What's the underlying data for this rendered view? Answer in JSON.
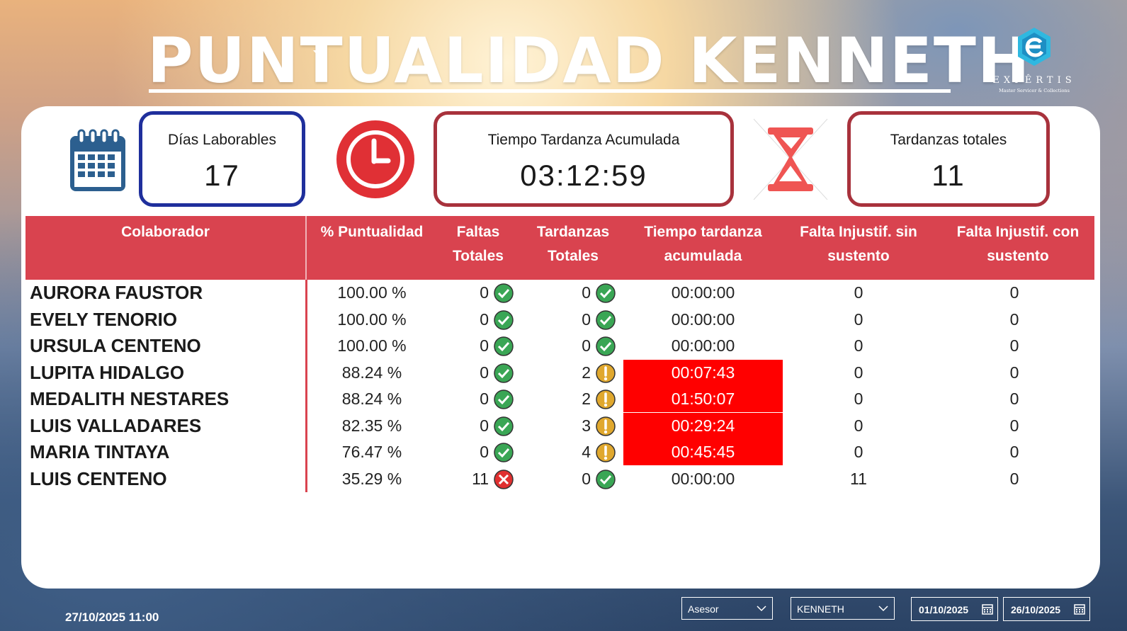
{
  "header": {
    "title": "PUNTUALIDAD KENNETH"
  },
  "logo": {
    "name": "EXPÊRTIS",
    "tagline": "Master Servicer & Collections",
    "icon": "expertis-e-logo"
  },
  "kpis": {
    "dias": {
      "label": "Días Laborables",
      "value": "17",
      "icon": "calendar-icon",
      "border_color": "#1f2f9c"
    },
    "tiempo": {
      "label": "Tiempo Tardanza Acumulada",
      "value": "03:12:59",
      "icon": "clock-icon",
      "border_color": "#a8323c"
    },
    "tardanzas": {
      "label": "Tardanzas totales",
      "value": "11",
      "icon": "hourglass-icon",
      "border_color": "#a8323c"
    }
  },
  "table": {
    "headers": {
      "colaborador": "Colaborador",
      "puntualidad": "% Puntualidad",
      "faltas_1": "Faltas",
      "faltas_2": "Totales",
      "tardanzas_1": "Tardanzas",
      "tardanzas_2": "Totales",
      "tiempo_1": "Tiempo tardanza",
      "tiempo_2": "acumulada",
      "sin_1": "Falta Injustif. sin",
      "sin_2": "sustento",
      "con_1": "Falta Injustif. con",
      "con_2": "sustento"
    },
    "rows": [
      {
        "name": "AURORA FAUSTOR",
        "pct": "100.00 %",
        "faltas": "0",
        "faltas_status": "ok",
        "tardanzas": "0",
        "tardanzas_status": "ok",
        "tiempo": "00:00:00",
        "late": false,
        "sin": "0",
        "con": "0"
      },
      {
        "name": "EVELY TENORIO",
        "pct": "100.00 %",
        "faltas": "0",
        "faltas_status": "ok",
        "tardanzas": "0",
        "tardanzas_status": "ok",
        "tiempo": "00:00:00",
        "late": false,
        "sin": "0",
        "con": "0"
      },
      {
        "name": "URSULA CENTENO",
        "pct": "100.00 %",
        "faltas": "0",
        "faltas_status": "ok",
        "tardanzas": "0",
        "tardanzas_status": "ok",
        "tiempo": "00:00:00",
        "late": false,
        "sin": "0",
        "con": "0"
      },
      {
        "name": "LUPITA HIDALGO",
        "pct": "88.24 %",
        "faltas": "0",
        "faltas_status": "ok",
        "tardanzas": "2",
        "tardanzas_status": "warn",
        "tiempo": "00:07:43",
        "late": true,
        "sin": "0",
        "con": "0"
      },
      {
        "name": "MEDALITH NESTARES",
        "pct": "88.24 %",
        "faltas": "0",
        "faltas_status": "ok",
        "tardanzas": "2",
        "tardanzas_status": "warn",
        "tiempo": "01:50:07",
        "late": true,
        "sin": "0",
        "con": "0"
      },
      {
        "name": "LUIS VALLADARES",
        "pct": "82.35 %",
        "faltas": "0",
        "faltas_status": "ok",
        "tardanzas": "3",
        "tardanzas_status": "warn",
        "tiempo": "00:29:24",
        "late": true,
        "sin": "0",
        "con": "0"
      },
      {
        "name": "MARIA TINTAYA",
        "pct": "76.47 %",
        "faltas": "0",
        "faltas_status": "ok",
        "tardanzas": "4",
        "tardanzas_status": "warn",
        "tiempo": "00:45:45",
        "late": true,
        "sin": "0",
        "con": "0"
      },
      {
        "name": "LUIS CENTENO",
        "pct": "35.29 %",
        "faltas": "11",
        "faltas_status": "bad",
        "tardanzas": "0",
        "tardanzas_status": "ok",
        "tiempo": "00:00:00",
        "late": false,
        "sin": "11",
        "con": "0"
      }
    ]
  },
  "footer": {
    "datetime": "27/10/2025 11:00",
    "slicer_field": "Asesor",
    "slicer_value": "KENNETH",
    "date_from": "01/10/2025",
    "date_to": "26/10/2025"
  },
  "colors": {
    "header_red": "#d9434f",
    "late_red": "#ff0000",
    "ok_green": "#3aa655",
    "warn_amber": "#e0a82e",
    "bad_red": "#e03030"
  }
}
